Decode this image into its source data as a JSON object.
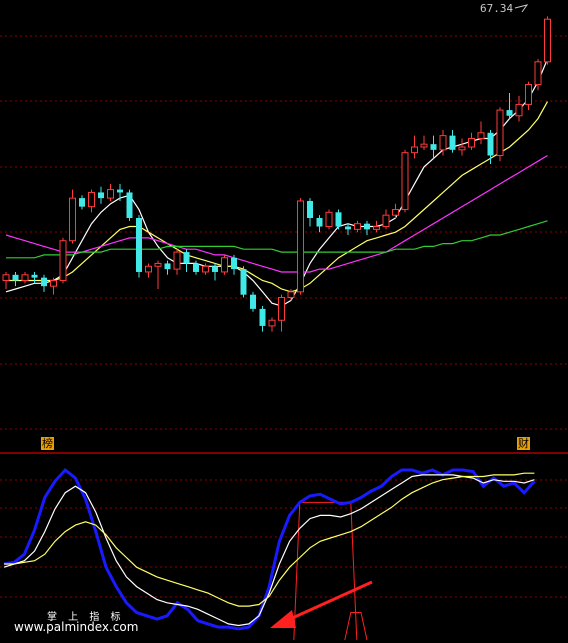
{
  "price_label": "67.34",
  "tags": {
    "left": "榜",
    "right": "财"
  },
  "watermark": {
    "top": "掌 上 指 标",
    "bottom": "www.palmindex.com"
  },
  "colors": {
    "background": "#000000",
    "grid": "#8b0000",
    "up_candle": "#ff3b3b",
    "down_candle": "#40e8e8",
    "ma_short": "#ffffff",
    "ma_mid": "#ffff66",
    "ma_long": "#ff33ff",
    "ma_longest": "#33cc33",
    "osc_blue": "#1a1aff",
    "osc_white": "#ffffff",
    "osc_yellow": "#ffff66",
    "signal": "#ff2020",
    "arrow": "#ff2020"
  },
  "chart_data": [
    {
      "type": "candlestick",
      "title": "",
      "ylim": [
        0,
        100
      ],
      "candles": [
        [
          28,
          30,
          25,
          31
        ],
        [
          30,
          28,
          26,
          31
        ],
        [
          28,
          30,
          27,
          31
        ],
        [
          30,
          29,
          27,
          31
        ],
        [
          29,
          26,
          24,
          30
        ],
        [
          26,
          28,
          23,
          29
        ],
        [
          28,
          42,
          27,
          43
        ],
        [
          42,
          57,
          41,
          60
        ],
        [
          57,
          54,
          53,
          58
        ],
        [
          54,
          59,
          52,
          60
        ],
        [
          59,
          57,
          55,
          61
        ],
        [
          57,
          60,
          56,
          62
        ],
        [
          60,
          59,
          56,
          62
        ],
        [
          59,
          50,
          49,
          60
        ],
        [
          50,
          31,
          29,
          51
        ],
        [
          31,
          33,
          29,
          34
        ],
        [
          33,
          34,
          25,
          35
        ],
        [
          34,
          32,
          30,
          35
        ],
        [
          32,
          38,
          30,
          39
        ],
        [
          38,
          34,
          31,
          39
        ],
        [
          34,
          31,
          30,
          35
        ],
        [
          31,
          33,
          30,
          34
        ],
        [
          33,
          31,
          28,
          34
        ],
        [
          31,
          36,
          30,
          37
        ],
        [
          36,
          32,
          30,
          37
        ],
        [
          32,
          23,
          22,
          33
        ],
        [
          23,
          18,
          17,
          24
        ],
        [
          18,
          12,
          10,
          19
        ],
        [
          12,
          14,
          10,
          15
        ],
        [
          14,
          22,
          10,
          23
        ],
        [
          22,
          24,
          21,
          25
        ],
        [
          24,
          56,
          23,
          57
        ],
        [
          56,
          50,
          47,
          57
        ],
        [
          50,
          47,
          45,
          51
        ],
        [
          47,
          52,
          46,
          53
        ],
        [
          52,
          47,
          46,
          53
        ],
        [
          47,
          46,
          44,
          48
        ],
        [
          46,
          48,
          45,
          49
        ],
        [
          48,
          46,
          44,
          49
        ],
        [
          46,
          47,
          45,
          49
        ],
        [
          47,
          51,
          46,
          53
        ],
        [
          51,
          53,
          50,
          55
        ],
        [
          53,
          73,
          52,
          74
        ],
        [
          73,
          75,
          71,
          79
        ],
        [
          75,
          76,
          74,
          79
        ],
        [
          76,
          74,
          71,
          79
        ],
        [
          74,
          79,
          72,
          81
        ],
        [
          79,
          74,
          73,
          81
        ],
        [
          74,
          75,
          72,
          78
        ],
        [
          75,
          78,
          74,
          80
        ],
        [
          78,
          80,
          76,
          84
        ],
        [
          80,
          72,
          69,
          81
        ],
        [
          72,
          88,
          70,
          89
        ],
        [
          88,
          86,
          85,
          94
        ],
        [
          86,
          90,
          84,
          93
        ],
        [
          90,
          97,
          88,
          98
        ],
        [
          97,
          105,
          95,
          106
        ],
        [
          105,
          120,
          104,
          121
        ]
      ],
      "series": [
        {
          "name": "",
          "color": "#ffffff",
          "values": [
            24,
            25,
            26,
            27,
            27,
            28,
            30,
            36,
            42,
            48,
            52,
            55,
            57,
            58,
            53,
            45,
            40,
            36,
            34,
            34,
            34,
            33,
            33,
            33,
            33,
            31,
            28,
            24,
            20,
            19,
            21,
            27,
            34,
            39,
            43,
            47,
            48,
            47,
            47,
            47,
            48,
            50,
            56,
            62,
            68,
            71,
            74,
            75,
            76,
            77,
            78,
            78,
            81,
            85,
            88,
            92,
            98,
            106
          ]
        },
        {
          "name": "",
          "color": "#ffff66",
          "values": [
            28,
            28,
            28,
            28,
            28,
            28,
            29,
            31,
            34,
            37,
            40,
            43,
            46,
            47,
            47,
            45,
            43,
            41,
            39,
            37,
            36,
            35,
            34,
            33,
            33,
            32,
            30,
            28,
            27,
            25,
            24,
            25,
            27,
            30,
            33,
            36,
            38,
            40,
            42,
            43,
            44,
            45,
            47,
            50,
            53,
            56,
            59,
            62,
            65,
            67,
            69,
            71,
            73,
            75,
            78,
            81,
            85,
            91
          ]
        },
        {
          "name": "",
          "color": "#ff33ff",
          "values": [
            44,
            43,
            42,
            41,
            40,
            39,
            38,
            38,
            38,
            39,
            40,
            41,
            42,
            43,
            43,
            43,
            42,
            41,
            40,
            39,
            39,
            38,
            37,
            37,
            36,
            35,
            34,
            33,
            32,
            31,
            31,
            31,
            31,
            32,
            32,
            33,
            34,
            35,
            36,
            37,
            38,
            40,
            42,
            44,
            46,
            48,
            50,
            52,
            54,
            56,
            58,
            60,
            62,
            64,
            66,
            68,
            70,
            72
          ]
        },
        {
          "name": "",
          "color": "#33cc33",
          "values": [
            36,
            36,
            36,
            36,
            37,
            37,
            37,
            37,
            38,
            38,
            38,
            39,
            39,
            39,
            39,
            39,
            39,
            40,
            40,
            40,
            40,
            40,
            40,
            40,
            40,
            39,
            39,
            39,
            39,
            38,
            38,
            38,
            38,
            38,
            38,
            38,
            38,
            38,
            38,
            38,
            38,
            39,
            39,
            39,
            40,
            40,
            41,
            41,
            42,
            42,
            43,
            44,
            44,
            45,
            46,
            47,
            48,
            49
          ]
        }
      ]
    },
    {
      "type": "line",
      "title": "",
      "ylim": [
        0,
        100
      ],
      "series": [
        {
          "name": "",
          "color": "#1a1aff",
          "stroke": 3,
          "values": [
            42,
            43,
            48,
            63,
            83,
            93,
            100,
            95,
            82,
            62,
            40,
            28,
            18,
            12,
            10,
            8,
            10,
            18,
            14,
            7,
            5,
            3,
            3,
            2,
            3,
            10,
            28,
            56,
            72,
            80,
            84,
            85,
            82,
            79,
            80,
            83,
            87,
            90,
            96,
            100,
            100,
            98,
            100,
            97,
            100,
            100,
            99,
            90,
            95,
            90,
            92,
            86,
            93
          ]
        },
        {
          "name": "",
          "color": "#ffffff",
          "stroke": 1.2,
          "values": [
            40,
            42,
            44,
            50,
            62,
            76,
            86,
            90,
            86,
            74,
            58,
            44,
            34,
            28,
            24,
            20,
            18,
            17,
            16,
            14,
            11,
            8,
            5,
            4,
            5,
            10,
            24,
            42,
            56,
            64,
            70,
            72,
            72,
            71,
            73,
            76,
            80,
            84,
            88,
            92,
            96,
            97,
            97,
            97,
            97,
            96,
            95,
            92,
            94,
            93,
            93,
            92,
            94
          ]
        },
        {
          "name": "",
          "color": "#ffff66",
          "stroke": 1.2,
          "values": [
            42,
            42,
            43,
            44,
            48,
            56,
            62,
            66,
            68,
            66,
            60,
            52,
            46,
            40,
            37,
            34,
            32,
            30,
            28,
            26,
            24,
            21,
            18,
            16,
            16,
            17,
            22,
            32,
            40,
            46,
            52,
            56,
            58,
            60,
            62,
            65,
            69,
            73,
            77,
            82,
            86,
            89,
            92,
            94,
            95,
            96,
            96,
            96,
            97,
            97,
            97,
            98,
            98
          ]
        }
      ],
      "signal_bars": [
        {
          "start": 29,
          "end": 34,
          "value": 80
        },
        {
          "start": 34,
          "end": 35,
          "value": 12
        }
      ],
      "annotation": "arrow pointing to low"
    }
  ]
}
